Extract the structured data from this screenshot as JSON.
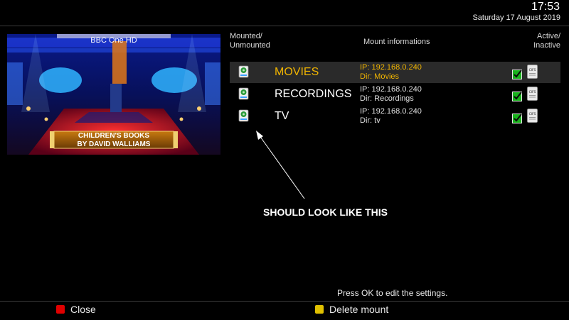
{
  "header": {
    "time": "17:53",
    "date": "Saturday 17 August 2019"
  },
  "preview": {
    "channel": "BBC One HD",
    "caption_line1": "CHILDREN'S BOOKS",
    "caption_line2": "BY DAVID WALLIAMS"
  },
  "columns": {
    "mounted_line1": "Mounted/",
    "mounted_line2": "Unmounted",
    "info": "Mount informations",
    "active_line1": "Active/",
    "active_line2": "Inactive"
  },
  "mounts": [
    {
      "name": "MOVIES",
      "ip": "IP: 192.168.0.240",
      "dir": "Dir: Movies",
      "active": true,
      "selected": true,
      "type_icon": "CIFS"
    },
    {
      "name": "RECORDINGS",
      "ip": "IP: 192.168.0.240",
      "dir": "Dir: Recordings",
      "active": true,
      "selected": false,
      "type_icon": "CIFS"
    },
    {
      "name": "TV",
      "ip": "IP: 192.168.0.240",
      "dir": "Dir: tv",
      "active": true,
      "selected": false,
      "type_icon": "CIFS"
    }
  ],
  "annotation": {
    "text": "SHOULD LOOK LIKE THIS"
  },
  "footer": {
    "hint": "Press OK to edit the settings.",
    "close_label": "Close",
    "close_color": "#e00000",
    "delete_label": "Delete mount",
    "delete_color": "#e0c000"
  },
  "colors": {
    "selected_text": "#f0b400",
    "selected_row": "#2a2a2a",
    "check_green": "#19b21c"
  }
}
